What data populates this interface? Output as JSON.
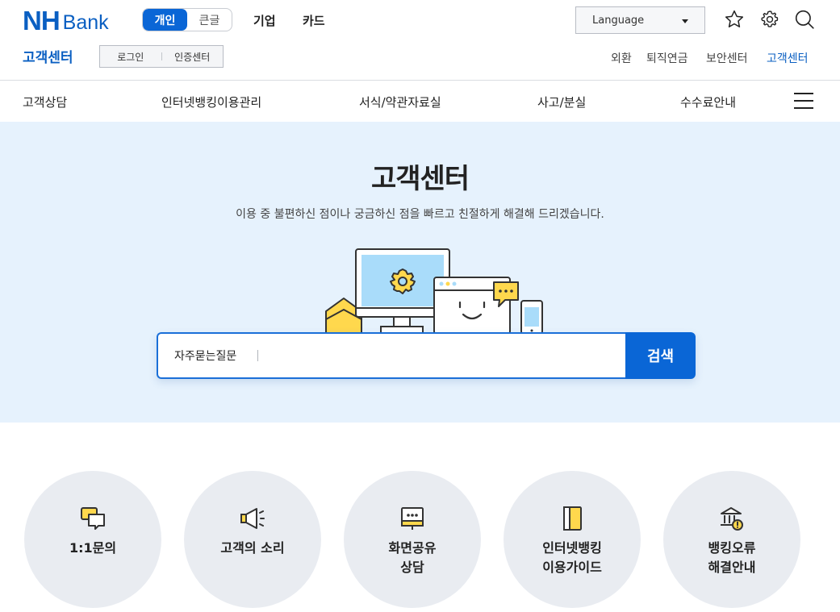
{
  "header": {
    "logo_nh": "NH",
    "logo_bank": "Bank",
    "segment": [
      "개인",
      "큰글"
    ],
    "top_links": [
      "기업",
      "카드"
    ],
    "language_label": "Language",
    "sub_title": "고객센터",
    "login": "로그인",
    "cert": "인증센터",
    "util_links": [
      "외환",
      "퇴직연금",
      "보안센터",
      "고객센터"
    ]
  },
  "gnb": [
    "고객상담",
    "인터넷뱅킹이용관리",
    "서식/약관자료실",
    "사고/분실",
    "수수료안내"
  ],
  "hero": {
    "title": "고객센터",
    "desc": "이용 중 불편하신 점이나 궁금하신 점을 빠르고 친절하게 해결해 드리겠습니다.",
    "search_label": "자주묻는질문",
    "search_value": "",
    "search_button": "검색"
  },
  "quick_menu": [
    {
      "label": "1:1문의",
      "icon": "chat-bubbles-icon"
    },
    {
      "label": "고객의 소리",
      "icon": "megaphone-icon"
    },
    {
      "label": "화면공유\n상담",
      "icon": "screen-share-icon"
    },
    {
      "label": "인터넷뱅킹\n이용가이드",
      "icon": "guide-book-icon"
    },
    {
      "label": "뱅킹오류\n해결안내",
      "icon": "bank-alert-icon"
    }
  ],
  "colors": {
    "brand": "#0a66d6",
    "hero_bg": "#e6f2fd",
    "accent_yellow": "#ffd84d"
  }
}
